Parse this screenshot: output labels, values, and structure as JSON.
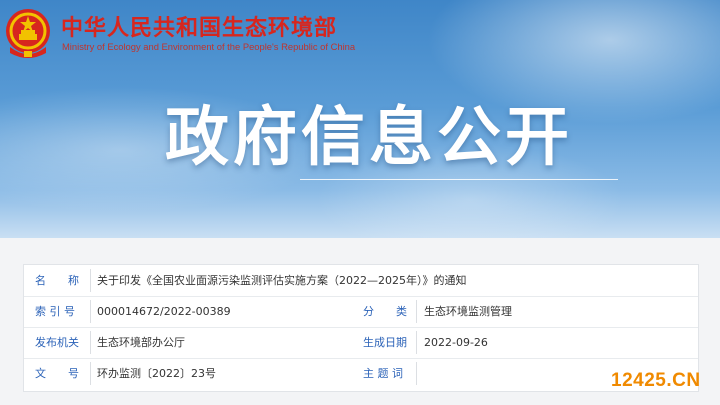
{
  "header": {
    "ministry_cn": "中华人民共和国生态环境部",
    "ministry_en": "Ministry of Ecology and Environment of the People's Republic of China",
    "emblem_icon": "national-emblem-icon"
  },
  "hero": {
    "title": "政府信息公开"
  },
  "info": {
    "name_label": "名　　称",
    "name_value": "关于印发《全国农业面源污染监测评估实施方案（2022—2025年）》的通知",
    "index_label": "索 引 号",
    "index_value": "000014672/2022-00389",
    "category_label": "分　　类",
    "category_value": "生态环境监测管理",
    "issuer_label": "发布机关",
    "issuer_value": "生态环境部办公厅",
    "date_label": "生成日期",
    "date_value": "2022-09-26",
    "docno_label": "文　　号",
    "docno_value": "环办监测〔2022〕23号",
    "subject_label": "主 题 词",
    "subject_value": ""
  },
  "watermark": "12425.CN",
  "colors": {
    "brand_red": "#d7261e",
    "label_blue": "#2c63b8",
    "watermark_orange": "#f08a00"
  }
}
